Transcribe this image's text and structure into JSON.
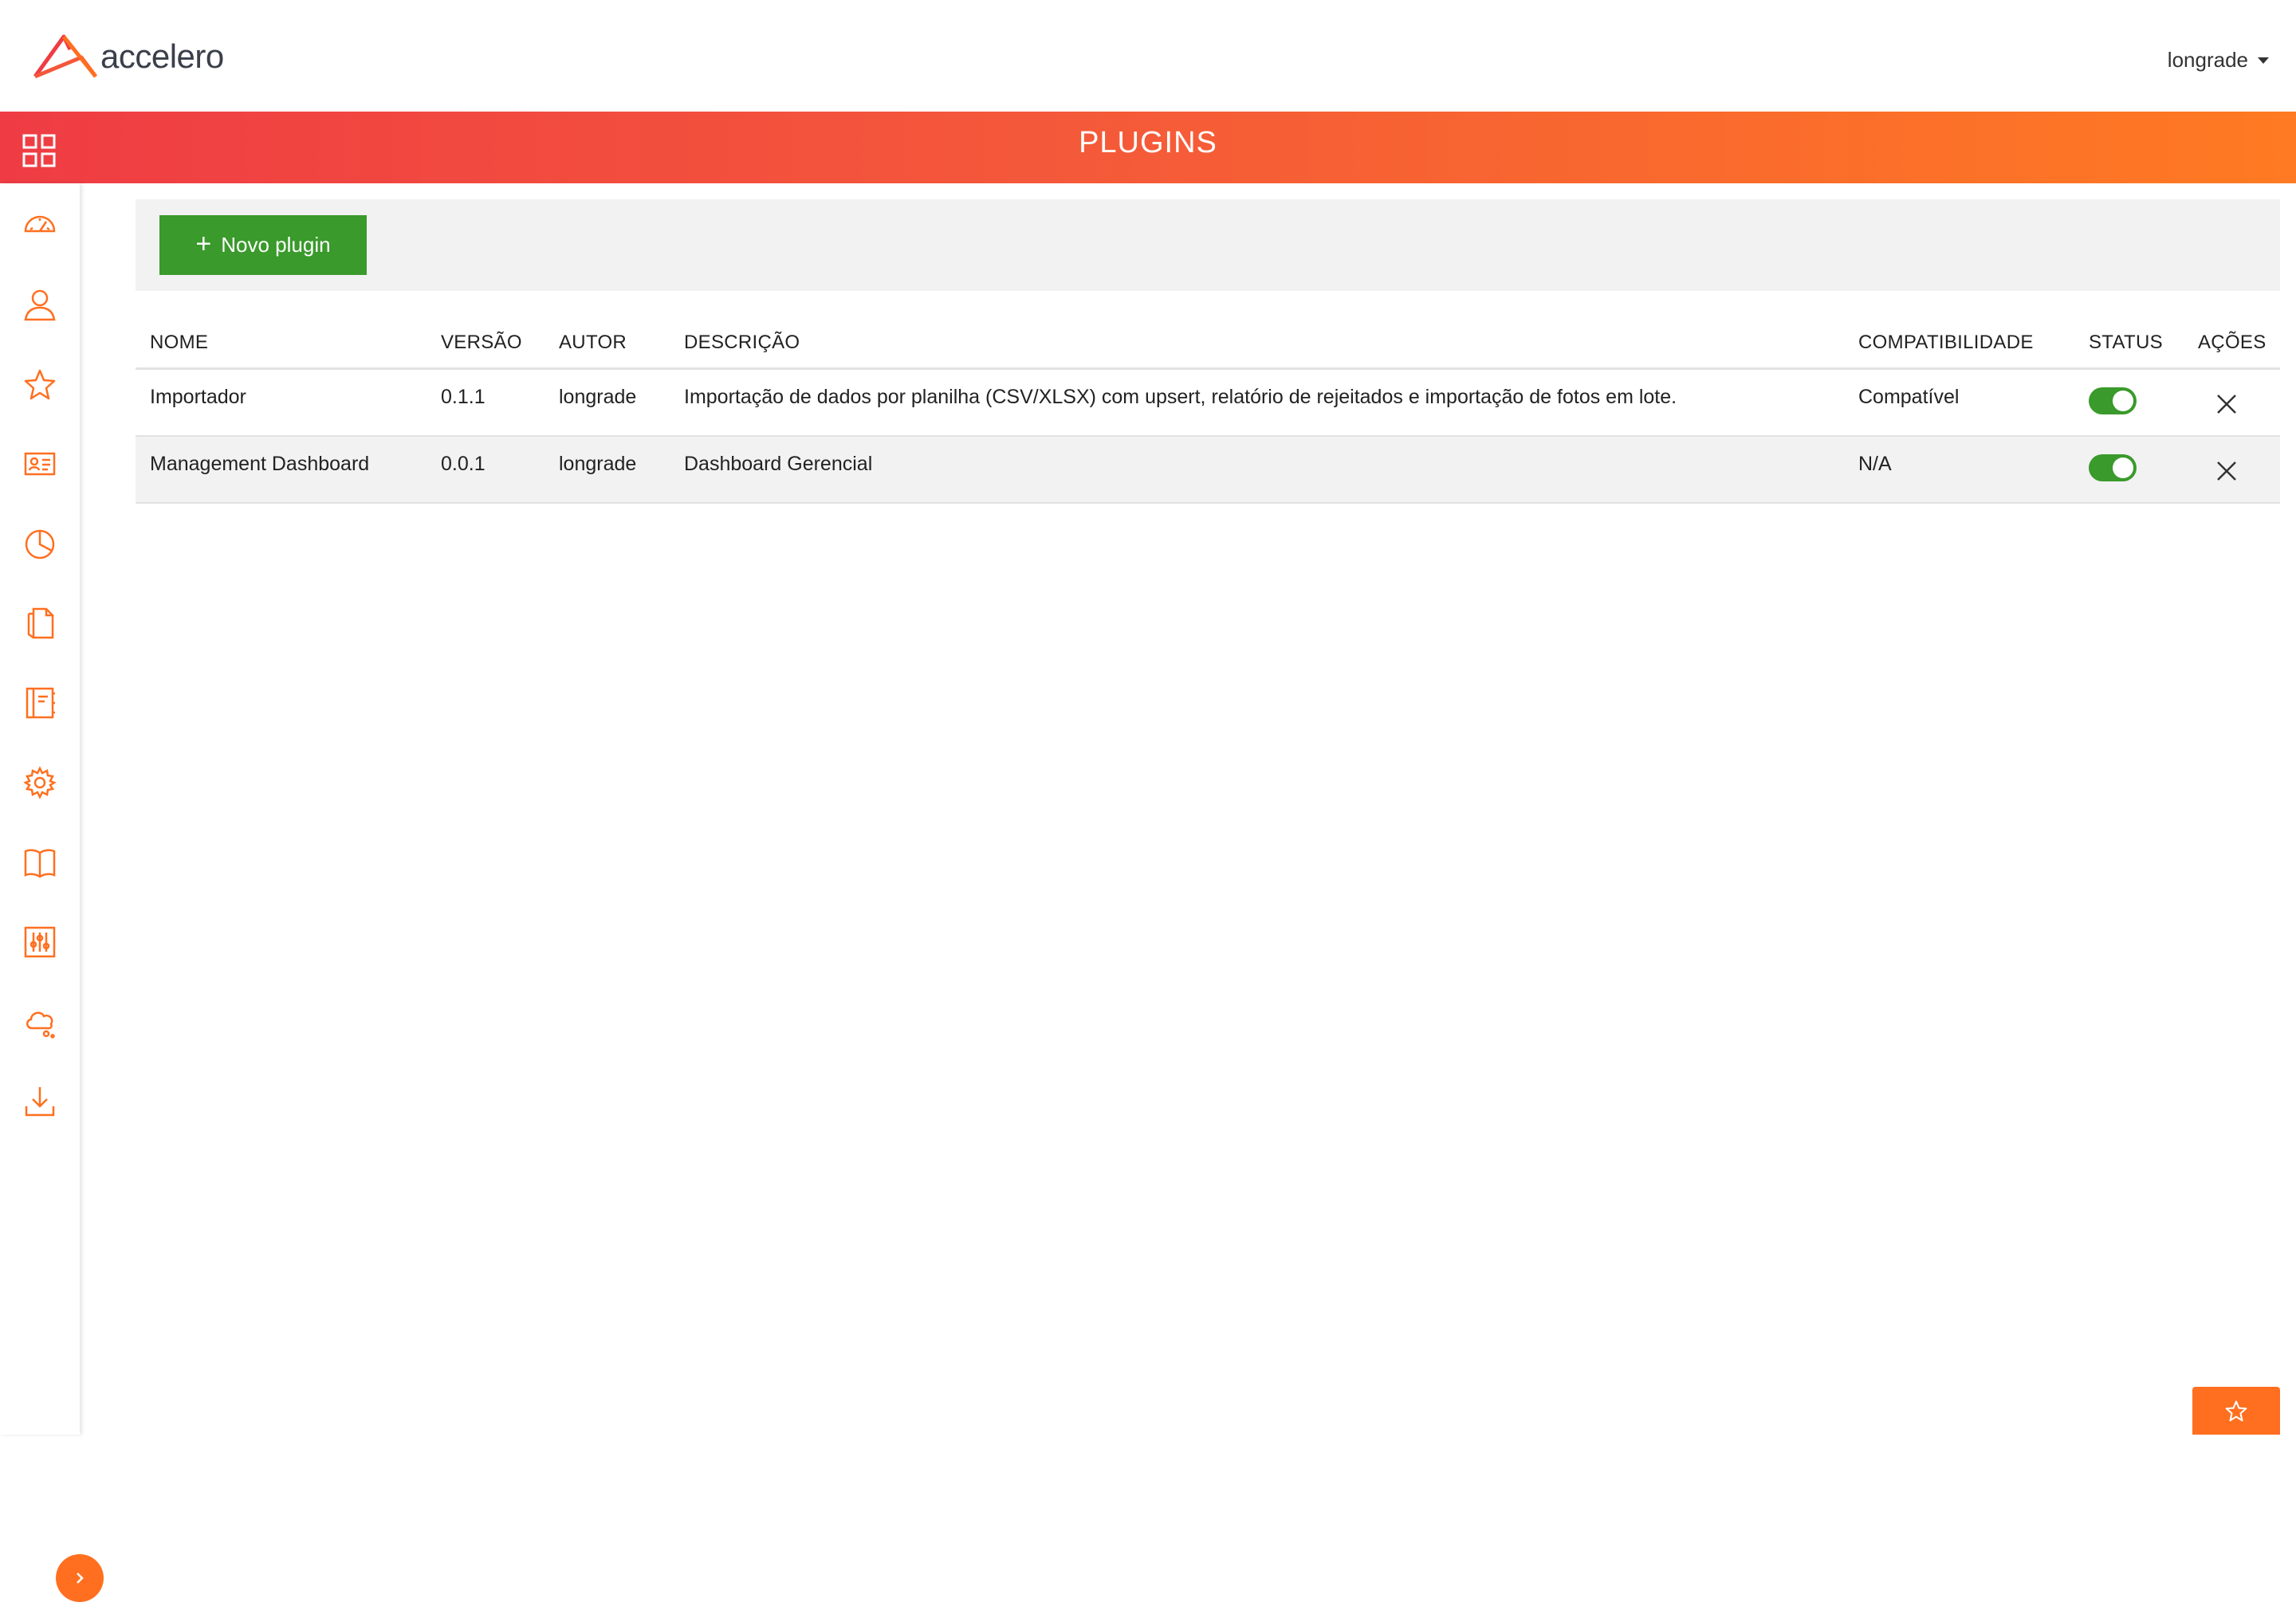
{
  "brand": {
    "name": "accelero",
    "accent": "#f4583a",
    "accent_end": "#ff7a22",
    "icon_color": "#ff6f1f"
  },
  "header": {
    "username": "longrade"
  },
  "banner": {
    "title": "PLUGINS"
  },
  "toolbar": {
    "new_plugin_label": "Novo plugin"
  },
  "sidebar": {
    "items": [
      {
        "icon": "speedometer-icon"
      },
      {
        "icon": "user-icon"
      },
      {
        "icon": "star-icon"
      },
      {
        "icon": "id-card-icon"
      },
      {
        "icon": "pie-chart-icon"
      },
      {
        "icon": "documents-icon"
      },
      {
        "icon": "notebook-icon"
      },
      {
        "icon": "gear-icon"
      },
      {
        "icon": "book-icon"
      },
      {
        "icon": "sliders-icon"
      },
      {
        "icon": "cloud-icon"
      },
      {
        "icon": "download-icon"
      }
    ]
  },
  "table": {
    "columns": {
      "nome": "NOME",
      "versao": "VERSÃO",
      "autor": "AUTOR",
      "descricao": "DESCRIÇÃO",
      "compat": "COMPATIBILIDADE",
      "status": "STATUS",
      "acoes": "AÇÕES"
    },
    "rows": [
      {
        "nome": "Importador",
        "versao": "0.1.1",
        "autor": "longrade",
        "descricao": "Importação de dados por planilha (CSV/XLSX) com upsert, relatório de rejeitados e importação de fotos em lote.",
        "compat": "Compatível",
        "status_enabled": true
      },
      {
        "nome": "Management Dashboard",
        "versao": "0.0.1",
        "autor": "longrade",
        "descricao": "Dashboard Gerencial",
        "compat": "N/A",
        "status_enabled": true
      }
    ]
  }
}
